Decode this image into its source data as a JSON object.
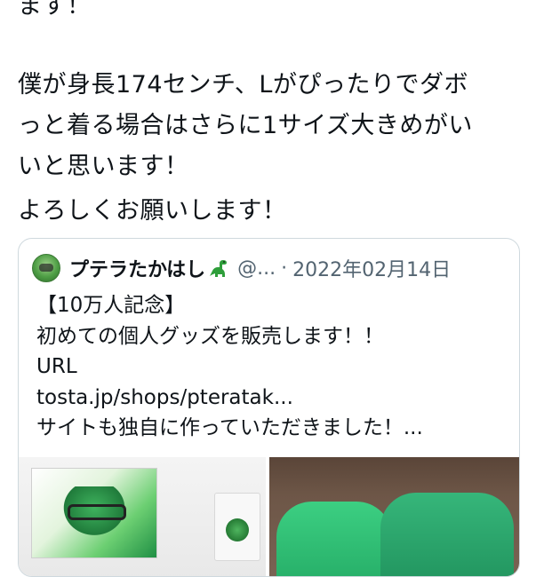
{
  "tweet": {
    "lines": [
      "ます！",
      "僕が身長174センチ、Lがぴったりでダボ",
      "っと着る場合はさらに1サイズ大きめがい",
      "いと思います！",
      "よろしくお願いします！"
    ]
  },
  "quoted_tweet": {
    "author_name": "プテラたかはし",
    "handle": "@...",
    "separator": "·",
    "date": "2022年02月14日",
    "lines": [
      "【10万人記念】",
      "初めての個人グッズを販売します！！",
      "URL",
      "tosta.jp/shops/pteratak...",
      "サイトも独自に作っていただきました！..."
    ],
    "media": [
      {
        "icon": "poster-photo"
      },
      {
        "icon": "hoodie-photo"
      }
    ]
  },
  "colors": {
    "text": "#0f1419",
    "secondary": "#536471",
    "border": "#cfd9de",
    "hoodie_green": "#2bb56e"
  }
}
